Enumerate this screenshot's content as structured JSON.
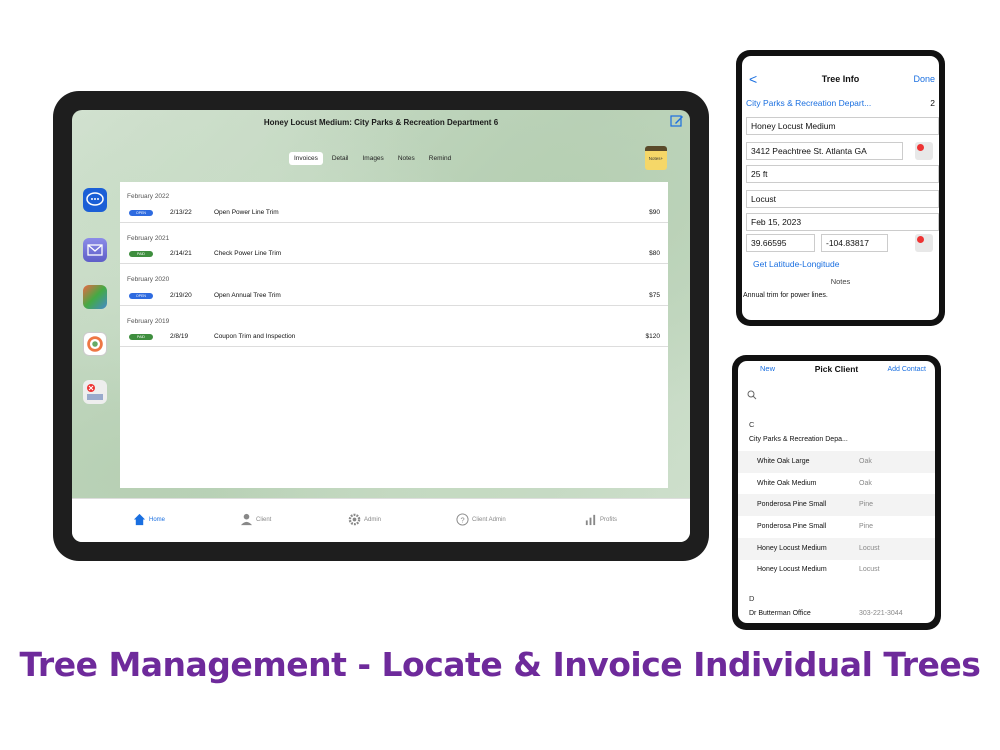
{
  "ipad": {
    "title": "Honey Locust Medium: City Parks & Recreation Department 6",
    "tabs": [
      "Invoices",
      "Detail",
      "Images",
      "Notes",
      "Remind"
    ],
    "notes_pad_label": "Notes+",
    "invoice_groups": [
      {
        "year_label": "February 2022",
        "status": "OPEN",
        "date": "2/13/22",
        "desc": "Open Power Line Trim",
        "amount": "$90"
      },
      {
        "year_label": "February 2021",
        "status": "PAID",
        "date": "2/14/21",
        "desc": "Check Power Line Trim",
        "amount": "$80"
      },
      {
        "year_label": "February 2020",
        "status": "OPEN",
        "date": "2/19/20",
        "desc": "Open Annual Tree Trim",
        "amount": "$75"
      },
      {
        "year_label": "February 2019",
        "status": "PAID",
        "date": "2/8/19",
        "desc": "Coupon Trim and Inspection",
        "amount": "$120"
      }
    ],
    "tabbar": [
      "Home",
      "Client",
      "Admin",
      "Client Admin",
      "Profits"
    ]
  },
  "tree_info": {
    "back": "<",
    "title": "Tree Info",
    "done": "Done",
    "client": "City Parks & Recreation Depart...",
    "count": "2",
    "name": "Honey Locust Medium",
    "address": "3412 Peachtree St.  Atlanta GA",
    "height": "25 ft",
    "species": "Locust",
    "date": "Feb 15, 2023",
    "latitude": "39.66595",
    "longitude": "-104.83817",
    "link": "Get Latitude-Longitude",
    "notes_label": "Notes",
    "notes_text": "Annual trim for power lines."
  },
  "pick_client": {
    "new": "New",
    "title": "Pick Client",
    "add": "Add Contact",
    "section_c": "C",
    "client_c": "City Parks & Recreation Depa...",
    "trees": [
      {
        "name": "White Oak Large",
        "type": "Oak"
      },
      {
        "name": "White Oak Medium",
        "type": "Oak"
      },
      {
        "name": "Ponderosa Pine Small",
        "type": "Pine"
      },
      {
        "name": "Ponderosa Pine Small",
        "type": "Pine"
      },
      {
        "name": "Honey Locust Medium",
        "type": "Locust"
      },
      {
        "name": "Honey Locust Medium",
        "type": "Locust"
      }
    ],
    "section_d": "D",
    "client_d": "Dr Butterman Office",
    "client_d_phone": "303-221-3044"
  },
  "headline": "Tree Management - Locate & Invoice Individual Trees"
}
